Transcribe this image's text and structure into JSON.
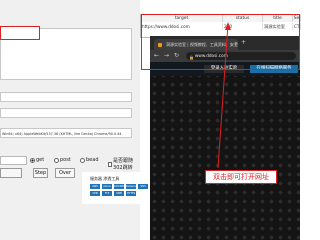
{
  "tool": {
    "user_agent": "Win64; x64) AppleWebKit/537.36 (KHTML, like Gecko) Chrome/90.0.44",
    "method_selected": "get",
    "radios": [
      {
        "label": "get",
        "checked": true
      },
      {
        "label": "post",
        "checked": false
      },
      {
        "label": "bead",
        "checked": false
      }
    ],
    "checkbox_label": "是否跟随302跳转",
    "buttons": {
      "left": "",
      "step": "Step",
      "over": "Over"
    }
  },
  "table": {
    "headers": [
      "target",
      "status",
      "title",
      "Se"
    ],
    "row": [
      "https://www.ddosi.com",
      "200",
      "洞源实验室",
      "CTNP+A"
    ]
  },
  "browser": {
    "tab_title": "洞源实验室 | 视频教程、工具资料、安全",
    "close_glyph": "×",
    "new_tab_glyph": "+",
    "back_glyph": "←",
    "forward_glyph": "→",
    "reload_glyph": "↻",
    "url": "www.ddosi.com",
    "site_buttons": [
      "登录入驻实验",
      "在线扫描网络服务"
    ],
    "panel_title": "服务器 渗透工具",
    "chips": [
      "AWS",
      "Azure",
      "DOCKER",
      "Kubernetes",
      "SSH",
      "VPN",
      "FTP",
      "SMB",
      "HTTPS"
    ]
  },
  "annotation": {
    "text": "双击即可打开网址",
    "color": "#e02020"
  }
}
